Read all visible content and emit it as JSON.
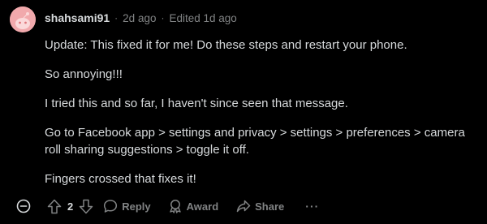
{
  "comment": {
    "author": "shahsami91",
    "separator": "·",
    "time_ago": "2d ago",
    "edited_label": "Edited 1d ago",
    "paragraphs": [
      "Update: This fixed it for me! Do these steps and restart your phone.",
      "So annoying!!!",
      "I tried this and so far, I haven't since seen that message.",
      "Go to Facebook app > settings and privacy > settings > preferences > camera roll sharing suggestions > toggle it off.",
      "Fingers crossed that fixes it!"
    ]
  },
  "actions": {
    "vote_count": "2",
    "reply_label": "Reply",
    "award_label": "Award",
    "share_label": "Share",
    "more_label": "···"
  },
  "icons": {
    "collapse": "minus-circle-icon",
    "upvote": "arrow-up-icon",
    "downvote": "arrow-down-icon",
    "reply": "speech-bubble-icon",
    "award": "award-icon",
    "share": "share-arrow-icon"
  },
  "colors": {
    "background": "#000000",
    "text": "#d7dadc",
    "muted": "#818384",
    "avatar_bg": "#f1a9ac"
  }
}
